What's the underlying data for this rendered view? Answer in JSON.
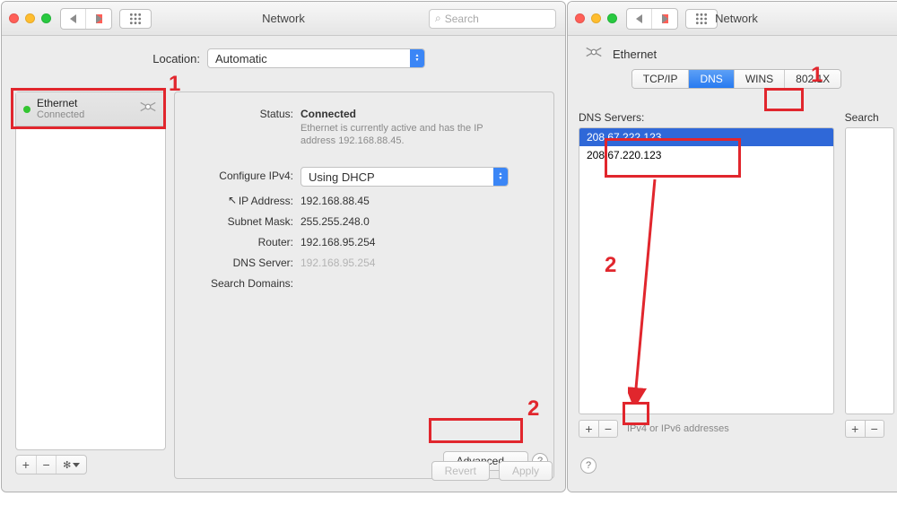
{
  "left": {
    "title": "Network",
    "search_placeholder": "Search",
    "location_label": "Location:",
    "location_value": "Automatic",
    "sidebar": {
      "name": "Ethernet",
      "state": "Connected"
    },
    "status_label": "Status:",
    "status_value": "Connected",
    "status_sub": "Ethernet is currently active and has the IP address 192.168.88.45.",
    "config_label": "Configure IPv4:",
    "config_value": "Using DHCP",
    "ip_label": "IP Address:",
    "ip_value": "192.168.88.45",
    "mask_label": "Subnet Mask:",
    "mask_value": "255.255.248.0",
    "router_label": "Router:",
    "router_value": "192.168.95.254",
    "dns_label": "DNS Server:",
    "dns_value": "192.168.95.254",
    "search_domains_label": "Search Domains:",
    "advanced": "Advanced…",
    "revert": "Revert",
    "apply": "Apply",
    "plus": "+",
    "minus": "−",
    "gear": "✻▾"
  },
  "right": {
    "title": "Network",
    "eth_title": "Ethernet",
    "tabs": {
      "tcp": "TCP/IP",
      "dns": "DNS",
      "wins": "WINS",
      "dot1x": "802.1X"
    },
    "dns_servers_label": "DNS Servers:",
    "dns1": "208.67.222.123",
    "dns2": "208.67.220.123",
    "search_domains_label": "Search",
    "hint": "IPv4 or IPv6 addresses",
    "plus": "+",
    "minus": "−"
  },
  "ann": {
    "one": "1",
    "two": "2"
  },
  "search_icon": "⌕"
}
